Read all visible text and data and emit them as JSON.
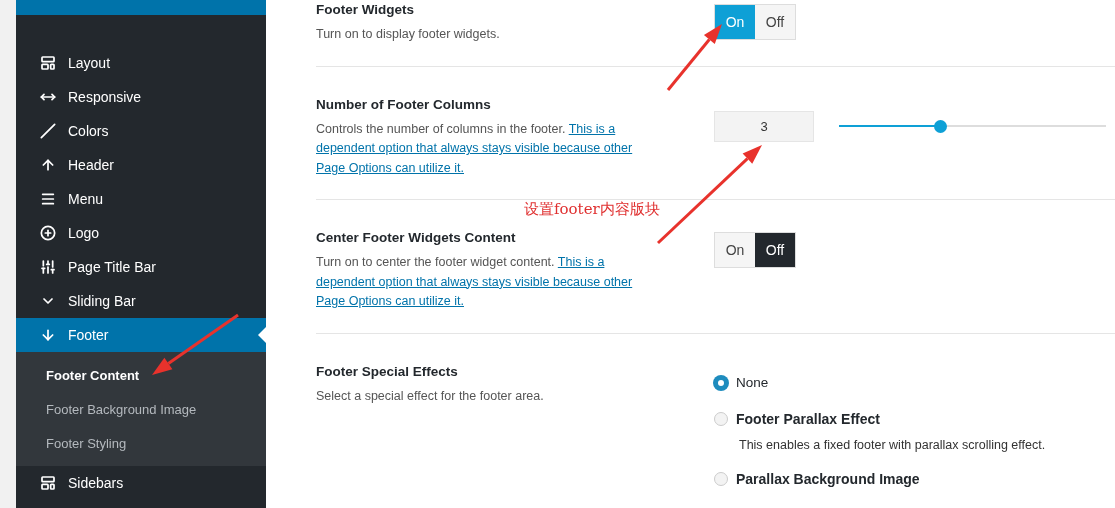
{
  "sidebar": {
    "items": [
      {
        "label": "Layout",
        "selected": false
      },
      {
        "label": "Responsive",
        "selected": false
      },
      {
        "label": "Colors",
        "selected": false
      },
      {
        "label": "Header",
        "selected": false
      },
      {
        "label": "Menu",
        "selected": false
      },
      {
        "label": "Logo",
        "selected": false
      },
      {
        "label": "Page Title Bar",
        "selected": false
      },
      {
        "label": "Sliding Bar",
        "selected": false
      },
      {
        "label": "Footer",
        "selected": true,
        "children": [
          {
            "label": "Footer Content",
            "selected": true
          },
          {
            "label": "Footer Background Image",
            "selected": false
          },
          {
            "label": "Footer Styling",
            "selected": false
          }
        ]
      },
      {
        "label": "Sidebars",
        "selected": false
      }
    ]
  },
  "settings": [
    {
      "kind": "toggle",
      "title": "Footer Widgets",
      "description": "Turn on to display footer widgets.",
      "options": [
        {
          "label": "On",
          "selected": true
        },
        {
          "label": "Off",
          "selected": false
        }
      ]
    },
    {
      "kind": "number-slider",
      "title": "Number of Footer Columns",
      "description": "Controls the number of columns in the footer.",
      "link_lines": [
        "This is a",
        "dependent option that always stays visible because other",
        "Page Options can utilize it."
      ],
      "value": "3",
      "level": 0.38
    },
    {
      "kind": "toggle",
      "title": "Center Footer Widgets Content",
      "description": "Turn on to center the footer widget content.",
      "link_lines": [
        "This is a",
        "dependent option that always stays visible because other",
        "Page Options can utilize it."
      ],
      "options": [
        {
          "label": "On",
          "selected": false
        },
        {
          "label": "Off",
          "selected": true
        }
      ]
    },
    {
      "kind": "radio",
      "title": "Footer Special Effects",
      "description": "Select a special effect for the footer area.",
      "options": [
        {
          "kind": "plain",
          "label": "None",
          "selected": true
        },
        {
          "kind": "titled",
          "label": "Footer Parallax Effect",
          "description": "This enables a fixed footer with parallax scrolling effect.",
          "selected": false
        },
        {
          "kind": "titled",
          "label": "Parallax Background Image",
          "selected": false
        }
      ]
    }
  ],
  "annotation": {
    "text": "设置footer内容版块"
  }
}
